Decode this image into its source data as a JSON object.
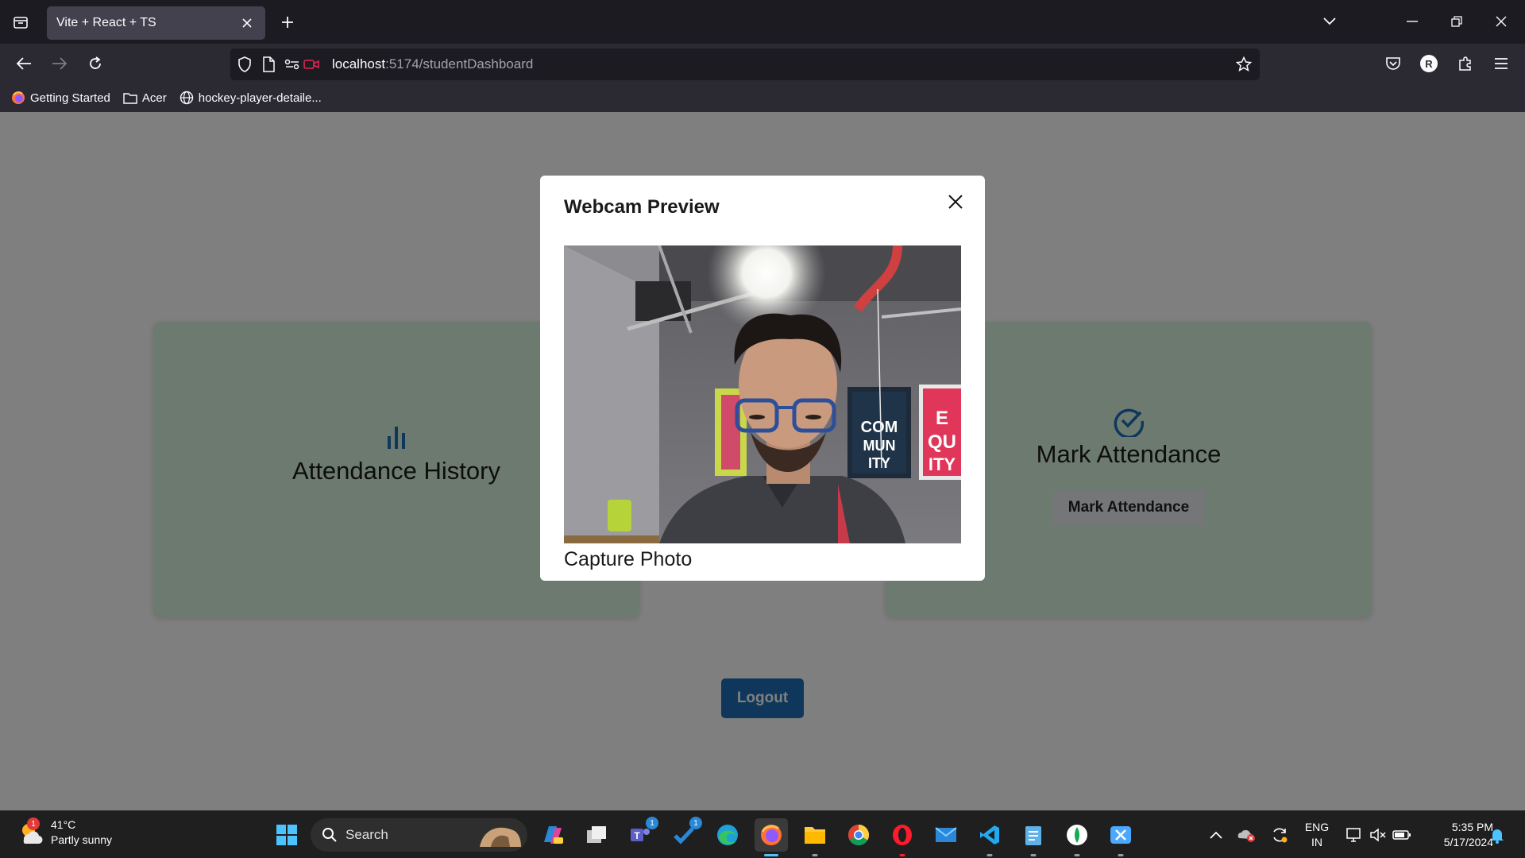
{
  "browser": {
    "tab_title": "Vite + React + TS",
    "url_host": "localhost",
    "url_path": ":5174/studentDashboard",
    "bookmarks": [
      "Getting Started",
      "Acer",
      "hockey-player-detaile..."
    ],
    "profile_initial": "R"
  },
  "dashboard": {
    "cards": [
      {
        "title": "Attendance History"
      },
      {
        "title": "Mark Attendance",
        "button": "Mark Attendance"
      }
    ],
    "logout_label": "Logout",
    "accent_color": "#1f6fb9"
  },
  "modal": {
    "title": "Webcam Preview",
    "capture_label": "Capture Photo",
    "webcam_poster_texts": [
      "COM MUN ITY",
      "E QU ITY"
    ]
  },
  "taskbar": {
    "weather_temp": "41°C",
    "weather_desc": "Partly sunny",
    "weather_badge": "1",
    "search_placeholder": "Search",
    "teams_badge": "1",
    "todo_badge": "1",
    "lang_top": "ENG",
    "lang_bottom": "IN",
    "time": "5:35 PM",
    "date": "5/17/2024"
  }
}
